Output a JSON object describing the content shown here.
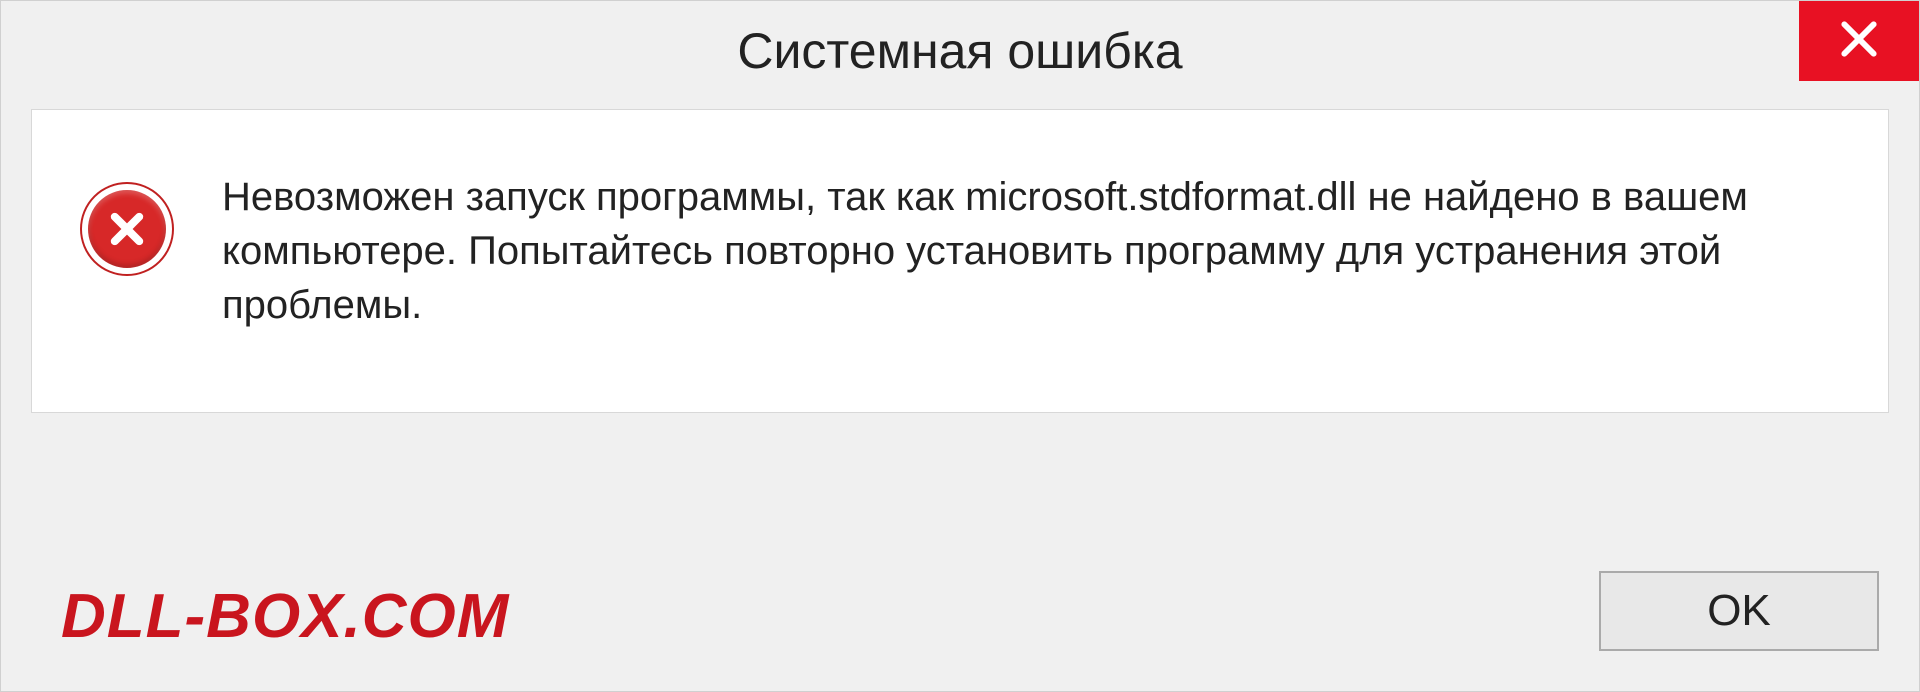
{
  "dialog": {
    "title": "Системная ошибка",
    "message": "Невозможен запуск программы, так как microsoft.stdformat.dll  не найдено в вашем компьютере. Попытайтесь повторно установить программу для устранения этой проблемы.",
    "ok_label": "OK"
  },
  "watermark": "DLL-BOX.COM"
}
